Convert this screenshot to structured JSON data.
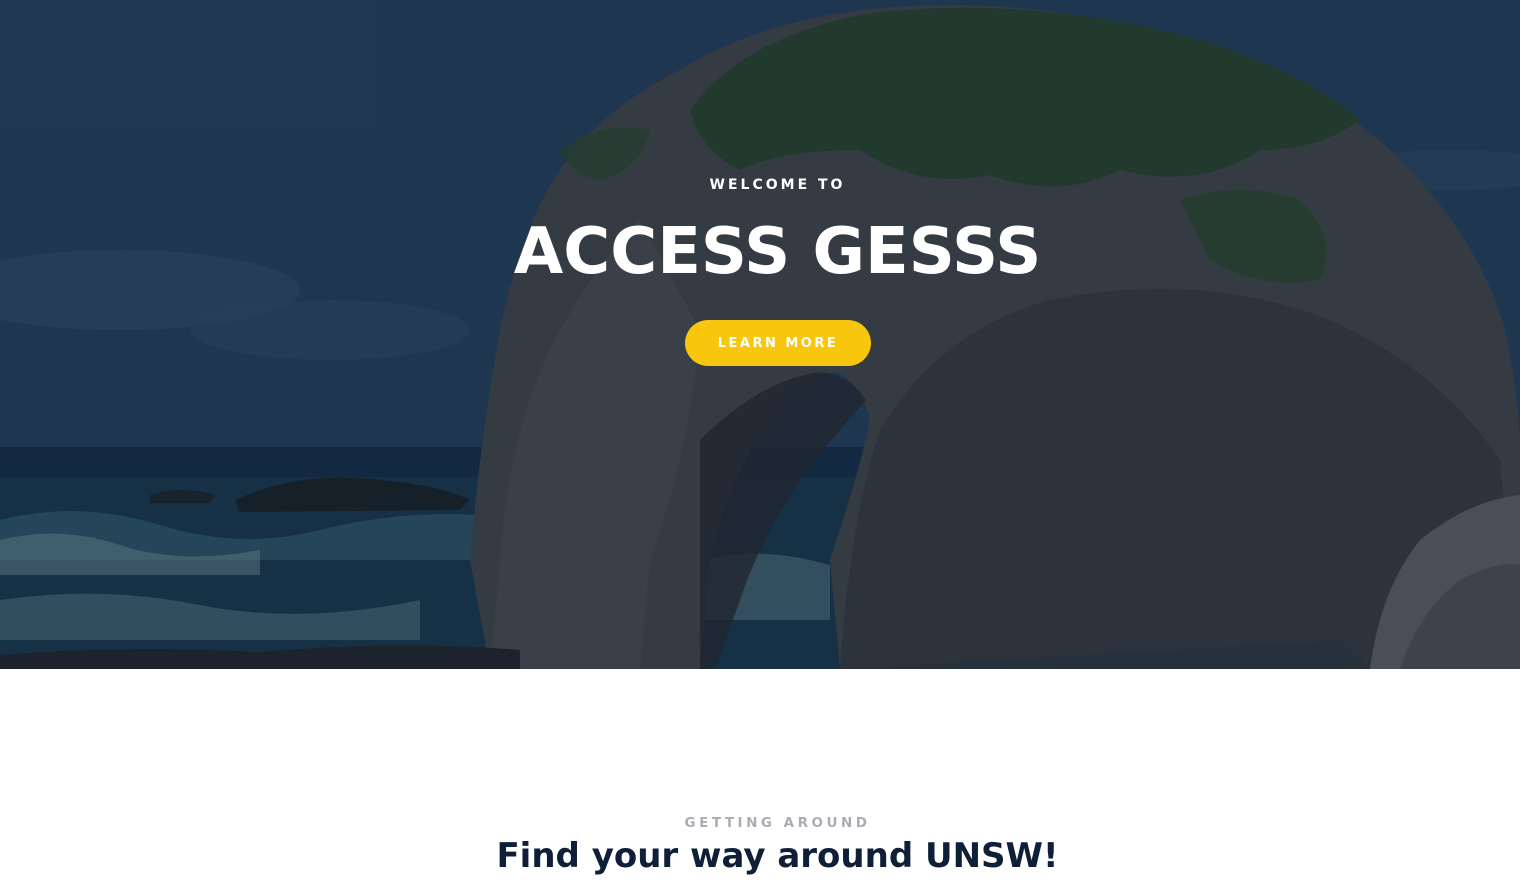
{
  "hero": {
    "welcome_label": "WELCOME TO",
    "title": "ACCESS GESSS",
    "button_label": "LEARN MORE",
    "background_image": "rock-arch-by-the-sea"
  },
  "section": {
    "kicker": "GETTING AROUND",
    "title": "Find your way around UNSW!"
  },
  "colors": {
    "accent": "#f7c60d",
    "heading_dark": "#0f1f38",
    "kicker_gray": "#a9adb3",
    "hero_overlay": "#0c1b30"
  }
}
